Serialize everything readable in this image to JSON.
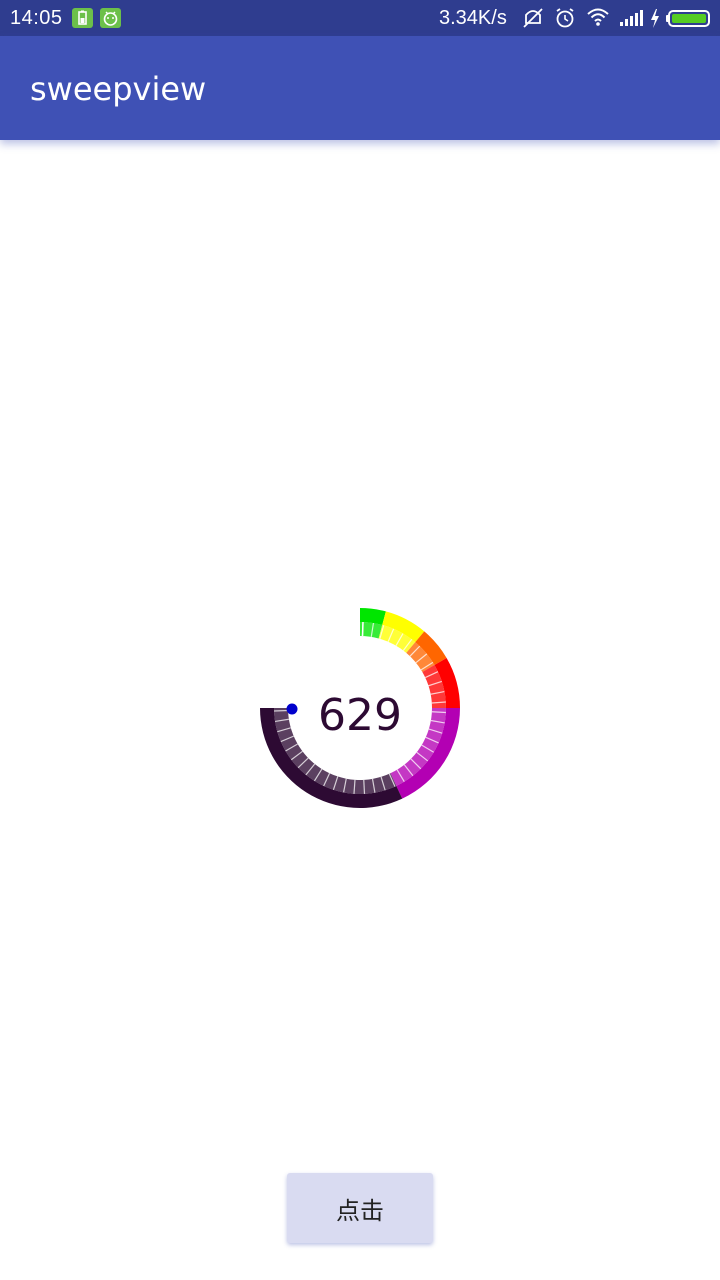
{
  "status_bar": {
    "time": "14:05",
    "network_speed": "3.34K/s",
    "icons": [
      "battery-saver-app-icon",
      "android-app-icon",
      "mute-icon",
      "alarm-clock-icon",
      "wifi-icon",
      "signal-icon",
      "charging-icon",
      "battery-icon"
    ],
    "battery_color": "#55cc22"
  },
  "app_bar": {
    "title": "sweepview",
    "color": "#3f51b5"
  },
  "gauge": {
    "value": "629",
    "segment_colors": [
      "#2d0a33",
      "#b300b3",
      "#ff0000",
      "#ff6600",
      "#ffff00",
      "#00e600"
    ],
    "indicator_color": "#0000cc"
  },
  "button": {
    "label": "点击"
  }
}
